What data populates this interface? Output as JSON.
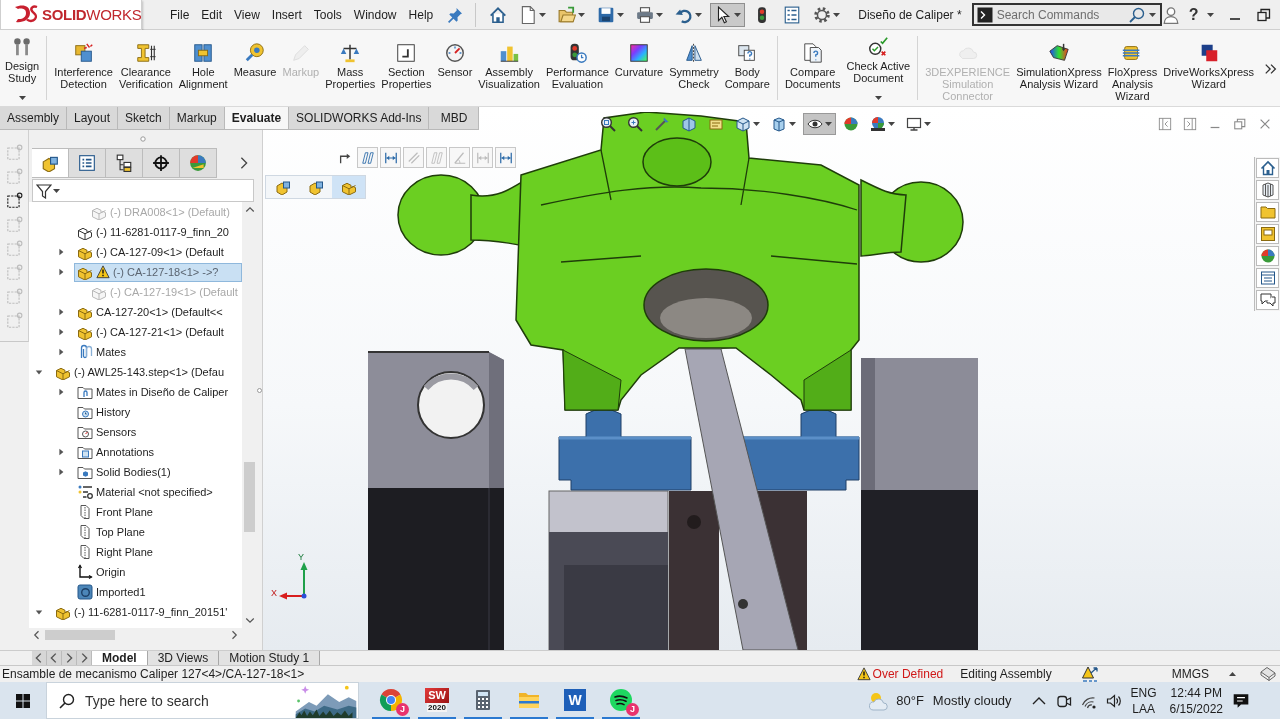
{
  "title_bar": {
    "logo_text": "**SOLID**WORKS",
    "menus": [
      "File",
      "Edit",
      "View",
      "Insert",
      "Tools",
      "Window",
      "Help"
    ],
    "quick_access": [
      {
        "kind": "home",
        "dropdown": false,
        "pressed": false
      },
      {
        "kind": "new",
        "dropdown": true,
        "pressed": false
      },
      {
        "kind": "open",
        "dropdown": true,
        "pressed": false
      },
      {
        "kind": "save",
        "dropdown": true,
        "pressed": false
      },
      {
        "kind": "print",
        "dropdown": true,
        "pressed": false
      },
      {
        "kind": "undo",
        "dropdown": true,
        "pressed": false
      },
      {
        "kind": "select",
        "dropdown": true,
        "pressed": true
      },
      {
        "kind": "rebuild",
        "dropdown": false,
        "pressed": false
      },
      {
        "kind": "file-properties",
        "dropdown": false,
        "pressed": false
      },
      {
        "kind": "options",
        "dropdown": true,
        "pressed": false
      }
    ],
    "document_title": "Diseño de Caliper *",
    "search": {
      "placeholder": "Search Commands"
    },
    "help": "?"
  },
  "ribbon": {
    "groups": [
      [
        {
          "label": "Design\nStudy",
          "disabled": false,
          "dropdown": true
        }
      ],
      [
        {
          "label": "Interference\nDetection",
          "disabled": false,
          "dropdown": false
        },
        {
          "label": "Clearance\nVerification",
          "disabled": false,
          "dropdown": false
        },
        {
          "label": "Hole\nAlignment",
          "disabled": false,
          "dropdown": false
        },
        {
          "label": "Measure",
          "disabled": false,
          "dropdown": false
        },
        {
          "label": "Markup",
          "disabled": true,
          "dropdown": false
        },
        {
          "label": "Mass\nProperties",
          "disabled": false,
          "dropdown": false
        },
        {
          "label": "Section\nProperties",
          "disabled": false,
          "dropdown": false
        },
        {
          "label": "Sensor",
          "disabled": false,
          "dropdown": false
        },
        {
          "label": "Assembly\nVisualization",
          "disabled": false,
          "dropdown": false
        },
        {
          "label": "Performance\nEvaluation",
          "disabled": false,
          "dropdown": false
        },
        {
          "label": "Curvature",
          "disabled": false,
          "dropdown": false
        },
        {
          "label": "Symmetry\nCheck",
          "disabled": false,
          "dropdown": false
        },
        {
          "label": "Body\nCompare",
          "disabled": false,
          "dropdown": false
        }
      ],
      [
        {
          "label": "Compare\nDocuments",
          "disabled": false,
          "dropdown": false
        },
        {
          "label": "Check Active\nDocument",
          "disabled": false,
          "dropdown": true
        }
      ],
      [
        {
          "label": "3DEXPERIENCE\nSimulation\nConnector",
          "disabled": true,
          "dropdown": false
        },
        {
          "label": "SimulationXpress\nAnalysis Wizard",
          "disabled": false,
          "dropdown": false
        },
        {
          "label": "FloXpress\nAnalysis\nWizard",
          "disabled": false,
          "dropdown": false
        },
        {
          "label": "DriveWorksXpress\nWizard",
          "disabled": false,
          "dropdown": false
        }
      ]
    ]
  },
  "command_tabs": [
    {
      "label": "Assembly",
      "selected": false
    },
    {
      "label": "Layout",
      "selected": false
    },
    {
      "label": "Sketch",
      "selected": false
    },
    {
      "label": "Markup",
      "selected": false
    },
    {
      "label": "Evaluate",
      "selected": true
    },
    {
      "label": "SOLIDWORKS Add-Ins",
      "selected": false
    },
    {
      "label": "MBD",
      "selected": false
    }
  ],
  "left_toolbar": [
    {
      "disabled": true
    },
    {
      "disabled": true
    },
    {
      "disabled": false
    },
    {
      "disabled": true
    },
    {
      "disabled": true
    },
    {
      "disabled": true
    },
    {
      "disabled": true
    },
    {
      "disabled": true
    }
  ],
  "feature_manager": {
    "tabs": [
      {
        "kind": "featuremanager",
        "selected": true
      },
      {
        "kind": "propertymanager",
        "selected": false
      },
      {
        "kind": "configurationmanager",
        "selected": false
      },
      {
        "kind": "dimxpertmanager",
        "selected": false
      },
      {
        "kind": "displaymanager",
        "selected": false
      }
    ],
    "tree": {
      "continued_items": [
        {
          "label": "(-) DRA008<1> (Default)",
          "kind": "part",
          "suppressed": true,
          "selected": false,
          "warning": false
        },
        {
          "label": "(-) 11-6281-0117-9_finn_20",
          "kind": "part-outline",
          "suppressed": false,
          "selected": false,
          "warning": false
        },
        {
          "label": "(-) CA-127-09<1> (Default",
          "kind": "part",
          "suppressed": false,
          "selected": false,
          "warning": false,
          "expanded": false
        },
        {
          "label": "(-) CA-127-18<1> ->?",
          "kind": "part",
          "suppressed": false,
          "selected": true,
          "warning": true,
          "expanded": false
        },
        {
          "label": "(-) CA-127-19<1> (Default",
          "kind": "part",
          "suppressed": true,
          "selected": false,
          "warning": false
        },
        {
          "label": "CA-127-20<1> (Default<<",
          "kind": "part",
          "suppressed": false,
          "selected": false,
          "warning": false,
          "expanded": false
        },
        {
          "label": "(-) CA-127-21<1> (Default",
          "kind": "part",
          "suppressed": false,
          "selected": false,
          "warning": false,
          "expanded": false
        },
        {
          "label": "Mates",
          "kind": "mates",
          "suppressed": false,
          "selected": false,
          "warning": false,
          "expanded": false
        }
      ],
      "items": [
        {
          "label": "(-) AWL25-143.step<1> (Defau",
          "kind": "part",
          "suppressed": false,
          "selected": false,
          "warning": false,
          "expanded": true,
          "children": [
            {
              "label": "Mates in Diseño de Caliper",
              "kind": "mates-folder",
              "selected": false,
              "expanded": false
            },
            {
              "label": "History",
              "kind": "history-folder",
              "selected": false
            },
            {
              "label": "Sensors",
              "kind": "sensors-folder",
              "selected": false
            },
            {
              "label": "Annotations",
              "kind": "annotations-folder",
              "selected": false,
              "expanded": false
            },
            {
              "label": "Solid Bodies(1)",
              "kind": "bodies-folder",
              "selected": false,
              "expanded": false
            },
            {
              "label": "Material <not specified>",
              "kind": "material",
              "selected": false
            },
            {
              "label": "Front Plane",
              "kind": "plane",
              "selected": false
            },
            {
              "label": "Top Plane",
              "kind": "plane",
              "selected": false
            },
            {
              "label": "Right Plane",
              "kind": "plane",
              "selected": false
            },
            {
              "label": "Origin",
              "kind": "origin",
              "selected": false
            },
            {
              "label": "Imported1",
              "kind": "imported",
              "selected": false
            }
          ]
        },
        {
          "label": "(-) 11-6281-0117-9_finn_20151'",
          "kind": "part",
          "suppressed": false,
          "selected": false,
          "warning": false,
          "expanded": true
        }
      ]
    }
  },
  "viewport": {
    "heads_up_toolbar": [
      {
        "kind": "zoom-fit",
        "dropdown": false,
        "pressed": false
      },
      {
        "kind": "zoom-area",
        "dropdown": false,
        "pressed": false
      },
      {
        "kind": "previous-view",
        "dropdown": false,
        "pressed": false
      },
      {
        "kind": "section-view",
        "dropdown": false,
        "pressed": false
      },
      {
        "kind": "dynamic-annotation",
        "dropdown": false,
        "pressed": false
      },
      {
        "kind": "view-orientation",
        "dropdown": true,
        "pressed": false
      },
      {
        "kind": "display-style",
        "dropdown": true,
        "pressed": false
      },
      {
        "kind": "hide-show",
        "dropdown": true,
        "pressed": true
      },
      {
        "kind": "edit-appearance",
        "dropdown": false,
        "pressed": false
      },
      {
        "kind": "apply-scene",
        "dropdown": true,
        "pressed": false
      },
      {
        "kind": "view-settings",
        "dropdown": true,
        "pressed": false
      }
    ],
    "mate_toolbar": [
      {
        "kind": "arrow",
        "disabled": false
      },
      {
        "kind": "slant-bars",
        "disabled": false
      },
      {
        "kind": "width",
        "disabled": false
      },
      {
        "kind": "diagonal",
        "disabled": true
      },
      {
        "kind": "slant-bars",
        "disabled": true
      },
      {
        "kind": "angle",
        "disabled": true
      },
      {
        "kind": "width",
        "disabled": true
      },
      {
        "kind": "width",
        "disabled": false
      }
    ],
    "breadcrumb": [
      {
        "kind": "assembly",
        "selected": false
      },
      {
        "kind": "assembly",
        "selected": false
      },
      {
        "kind": "part",
        "selected": true
      }
    ],
    "triad": {
      "x_label": "X",
      "y_label": "Y"
    }
  },
  "bottom_tabs": [
    {
      "label": "Model",
      "selected": true
    },
    {
      "label": "3D Views",
      "selected": false
    },
    {
      "label": "Motion Study 1",
      "selected": false
    }
  ],
  "status_bar": {
    "path": "Ensamble de mecanismo Caliper 127<4>/CA-127-18<1>",
    "mate_status": "Over Defined",
    "mode": "Editing Assembly",
    "units": "MMGS"
  },
  "taskbar": {
    "search": {
      "placeholder": "Type here to search"
    },
    "apps": [
      {
        "kind": "browser",
        "badge": "J",
        "running": true
      },
      {
        "kind": "solidworks",
        "logo_text": "SW",
        "version": "2020",
        "running": true
      },
      {
        "kind": "calculator",
        "running": true
      },
      {
        "kind": "file-explorer",
        "running": true
      },
      {
        "kind": "word",
        "logo_text": "W",
        "running": true
      },
      {
        "kind": "spotify",
        "badge": "J",
        "running": true
      }
    ],
    "weather": {
      "temperature": "80°F",
      "condition": "Mostly cloudy"
    },
    "language": {
      "code": "ENG",
      "layout": "LAA"
    },
    "clock": {
      "time": "12:44 PM",
      "date": "6/15/2022"
    }
  }
}
